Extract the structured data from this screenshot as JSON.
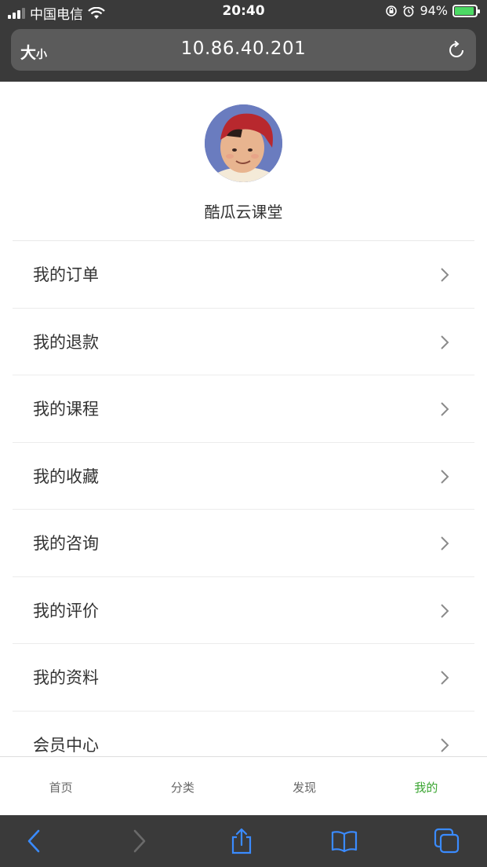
{
  "status_bar": {
    "carrier": "中国电信",
    "time": "20:40",
    "battery": "94%",
    "battery_level": 0.94
  },
  "browser": {
    "text_size_label_big": "大",
    "text_size_label_small": "小",
    "url": "10.86.40.201"
  },
  "profile": {
    "username": "酷瓜云课堂"
  },
  "menu": {
    "items": [
      {
        "label": "我的订单"
      },
      {
        "label": "我的退款"
      },
      {
        "label": "我的课程"
      },
      {
        "label": "我的收藏"
      },
      {
        "label": "我的咨询"
      },
      {
        "label": "我的评价"
      },
      {
        "label": "我的资料"
      },
      {
        "label": "会员中心"
      }
    ]
  },
  "tabbar": {
    "tabs": [
      {
        "label": "首页"
      },
      {
        "label": "分类"
      },
      {
        "label": "发现"
      },
      {
        "label": "我的"
      }
    ],
    "active_color": "#3aa531"
  },
  "icons": {
    "back": "chevron-left-icon",
    "forward": "chevron-right-icon",
    "share": "share-icon",
    "bookmarks": "book-icon",
    "tabs": "tabs-icon"
  }
}
